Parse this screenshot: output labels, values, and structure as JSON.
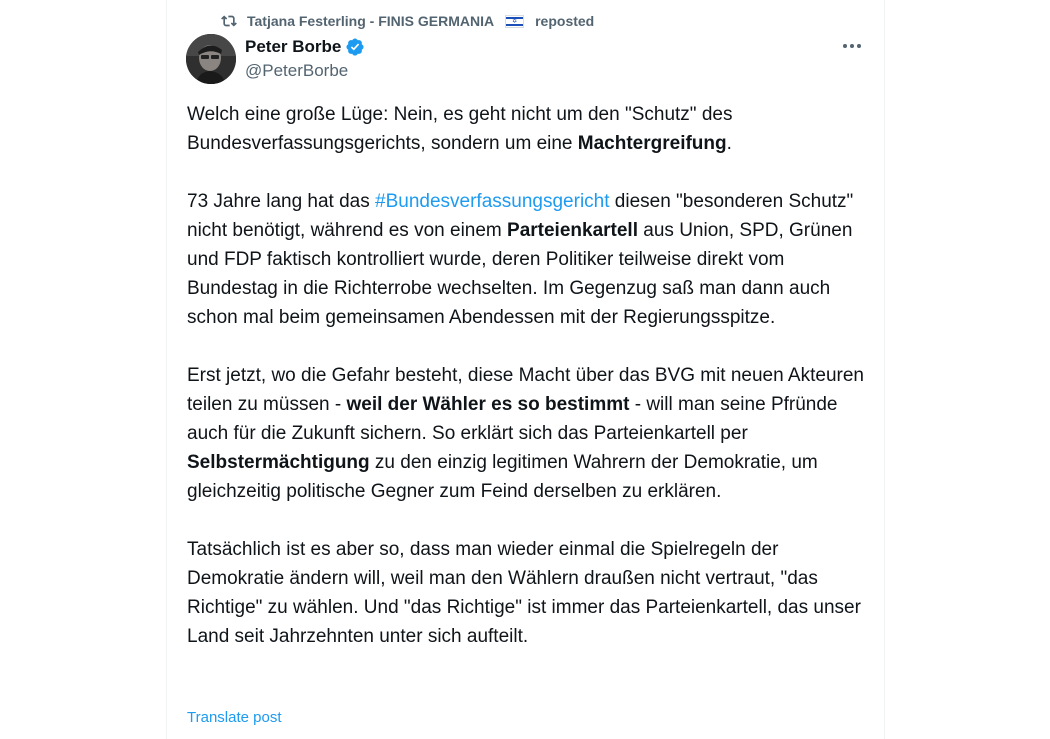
{
  "repost": {
    "user": "Tatjana Festerling - FINIS GERMANIA",
    "flag": "israel-flag",
    "label": "reposted"
  },
  "author": {
    "name": "Peter Borbe",
    "handle": "@PeterBorbe",
    "verified": true
  },
  "more_icon": "more-horizontal-icon",
  "tweet": {
    "p1": {
      "t1": "Welch eine große Lüge: Nein, es geht nicht um den \"Schutz\" des Bundesverfassungsgerichts, sondern um eine ",
      "b1": "Machtergreifung",
      "t2": "."
    },
    "p2": {
      "t1": "73 Jahre lang hat das ",
      "hashtag": "#Bundesverfassungsgericht",
      "t2": " diesen \"besonderen Schutz\" nicht benötigt, während es von einem ",
      "b1": "Parteienkartell",
      "t3": " aus Union, SPD, Grünen und FDP faktisch kontrolliert wurde, deren Politiker teilweise direkt vom Bundestag in die Richterrobe wechselten. Im Gegenzug saß man dann auch schon mal beim gemeinsamen Abendessen mit der Regierungsspitze."
    },
    "p3": {
      "t1": "Erst jetzt, wo die Gefahr besteht, diese Macht über das BVG mit neuen Akteuren teilen zu müssen - ",
      "b1": "weil der Wähler es so bestimmt",
      "t2": " - will man seine Pfründe auch für die Zukunft sichern. So erklärt sich das Parteienkartell per ",
      "b2": "Selbstermächtigung",
      "t3": " zu den einzig legitimen Wahrern der Demokratie, um gleichzeitig politische Gegner zum Feind derselben zu erklären."
    },
    "p4": {
      "t1": "Tatsächlich ist es aber so, dass man wieder einmal die Spielregeln der Demokratie ändern will, weil man den Wählern draußen nicht vertraut, \"das Richtige\" zu wählen. Und \"das Richtige\" ist immer das Parteienkartell, das unser Land seit Jahrzehnten unter sich aufteilt."
    }
  },
  "translate_label": "Translate post",
  "colors": {
    "text": "#0f1419",
    "secondary": "#536471",
    "accent": "#1d9bf0",
    "border": "#eff3f4"
  }
}
